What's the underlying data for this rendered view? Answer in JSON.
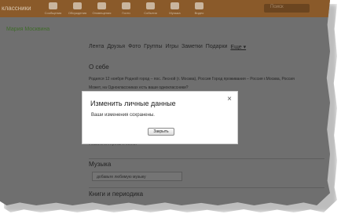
{
  "header": {
    "logo_text": "классники",
    "nav": [
      {
        "icon": "mail-icon",
        "label": "Сообщения"
      },
      {
        "icon": "people-icon",
        "label": "Обсуждения"
      },
      {
        "icon": "bell-icon",
        "label": "Оповещения"
      },
      {
        "icon": "guests-icon",
        "label": "Гости"
      },
      {
        "icon": "chat-icon",
        "label": "События"
      },
      {
        "icon": "music-icon",
        "label": "Музыка"
      },
      {
        "icon": "video-icon",
        "label": "Видео"
      }
    ],
    "search_placeholder": "Поиск"
  },
  "sidebar": {
    "user_name": "Мария Москвина"
  },
  "profile": {
    "tabs": [
      "Лента",
      "Друзья",
      "Фото",
      "Группы",
      "Игры",
      "Заметки",
      "Подарки"
    ],
    "more_tab": "Еще ▾",
    "about_title": "О себе",
    "about_line1": "Родился 12 ноября Родной город – пос. Лесной (г. Москва), Россия Город проживания – Россия г.Москва, Россия",
    "about_line2": "Может, на Одноклассниках есть ваши одноклассники?",
    "partial_line": "Указать интересы и хобби",
    "music_title": "Музыка",
    "music_placeholder": "добавьте любимую музыку",
    "books_title": "Книги и периодика"
  },
  "dialog": {
    "title": "Изменить личные данные",
    "message": "Ваши изменения сохранены.",
    "close_symbol": "×",
    "button_label": "Закрыть"
  }
}
